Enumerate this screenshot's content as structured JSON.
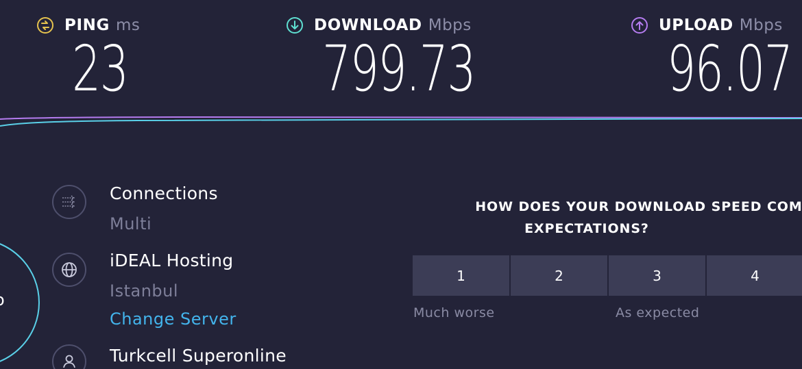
{
  "metrics": {
    "ping": {
      "label": "PING",
      "unit": "ms",
      "value": "23",
      "icon": "ping-icon",
      "color": "#e6c34e"
    },
    "download": {
      "label": "DOWNLOAD",
      "unit": "Mbps",
      "value": "799.73",
      "icon": "download-arrow-icon",
      "color": "#5fe0d2"
    },
    "upload": {
      "label": "UPLOAD",
      "unit": "Mbps",
      "value": "96.07",
      "icon": "upload-arrow-icon",
      "color": "#b57cf0"
    }
  },
  "graph": {
    "download_color": "#5ad0e8",
    "upload_color": "#b57cf0"
  },
  "connections": {
    "title": "Connections",
    "value": "Multi",
    "icon": "connections-icon"
  },
  "server": {
    "title": "iDEAL Hosting",
    "location": "Istanbul",
    "change_label": "Change Server",
    "icon": "globe-icon"
  },
  "provider": {
    "title": "Turkcell Superonline",
    "icon": "user-icon"
  },
  "gauge": {
    "value_fragment": "o",
    "color": "#5ad0e8"
  },
  "survey": {
    "question_line1": "HOW DOES YOUR DOWNLOAD SPEED COMPARE",
    "question_line2": "EXPECTATIONS?",
    "ratings": [
      "1",
      "2",
      "3",
      "4"
    ],
    "caption_low": "Much worse",
    "caption_mid": "As expected"
  },
  "colors": {
    "background": "#232338",
    "accent_link": "#43b4ec",
    "muted_text": "#7e7f99"
  }
}
